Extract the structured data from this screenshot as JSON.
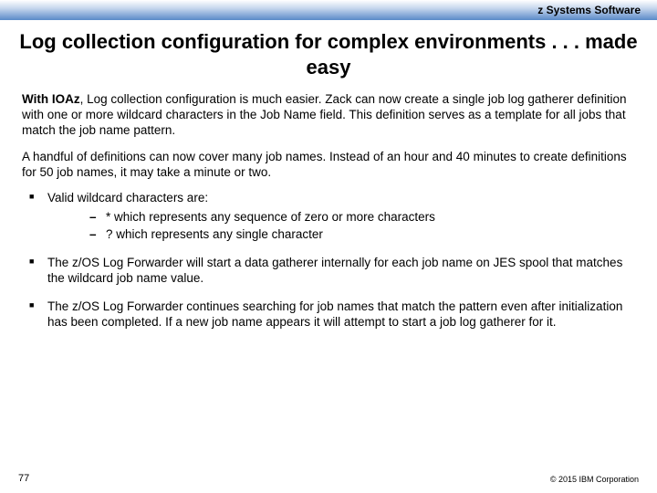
{
  "header": {
    "brand": "z Systems Software"
  },
  "title": "Log collection configuration for complex environments . . . made easy",
  "paragraphs": {
    "p1_lead": "With IOAz",
    "p1_rest": ", Log collection configuration is much easier.  Zack can now create a single job log gatherer definition with one or more wildcard characters in the Job Name field. This definition serves as a template for all jobs that match the job name pattern.",
    "p2": "A handful of definitions can now cover many job names. Instead of an hour and 40 minutes to create definitions for 50 job names, it may take a minute or two."
  },
  "bullets": {
    "b1": "Valid wildcard characters are:",
    "b1_sub1": "* which represents any sequence of zero or more characters",
    "b1_sub2": "? which represents any single character",
    "b2": "The z/OS Log Forwarder will start a data gatherer internally for each job name on JES spool that matches the wildcard job name value.",
    "b3": "The z/OS Log Forwarder continues searching for job names that match the pattern even after initialization has been completed. If a new job name appears it will attempt to start a job log gatherer for it."
  },
  "footer": {
    "page": "77",
    "copyright": "© 2015 IBM Corporation"
  }
}
